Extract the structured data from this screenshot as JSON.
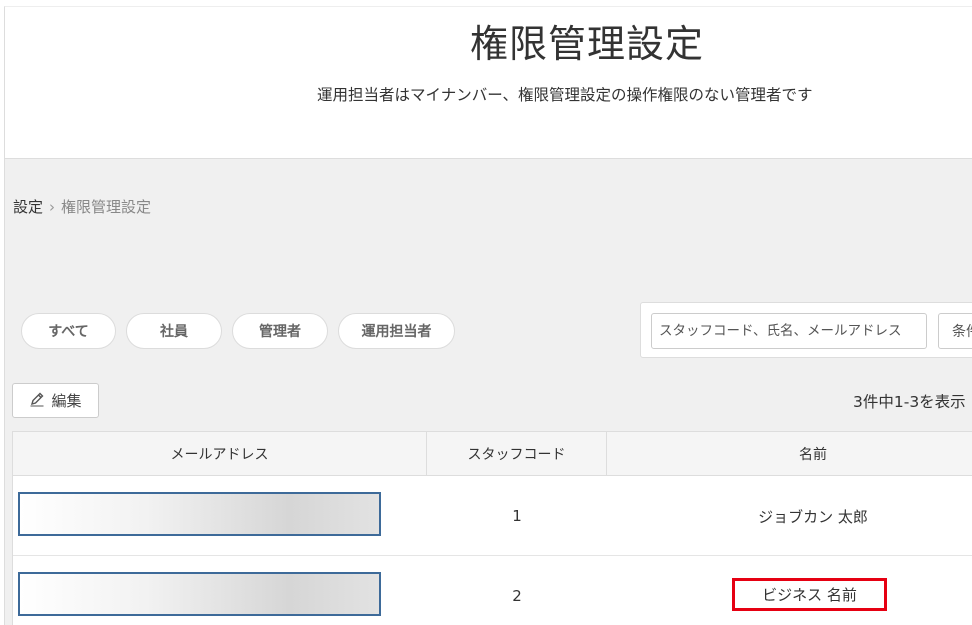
{
  "header": {
    "title": "権限管理設定",
    "description": "運用担当者はマイナンバー、権限管理設定の操作権限のない管理者です"
  },
  "breadcrumb": {
    "root": "設定",
    "separator": "›",
    "current": "権限管理設定"
  },
  "filters": [
    {
      "label": "すべて"
    },
    {
      "label": "社員"
    },
    {
      "label": "管理者"
    },
    {
      "label": "運用担当者"
    }
  ],
  "search": {
    "placeholder": "スタッフコード、氏名、メールアドレス",
    "value": "",
    "condition_label": "条件"
  },
  "toolbar": {
    "edit_label": "編集",
    "edit_icon": "pencil-icon",
    "count_text": "3件中1-3を表示"
  },
  "table": {
    "columns": [
      "メールアドレス",
      "スタッフコード",
      "名前"
    ],
    "rows": [
      {
        "email": "",
        "staff_code": "1",
        "name": "ジョブカン 太郎"
      },
      {
        "email": "",
        "staff_code": "2",
        "name": "ビジネス 名前"
      }
    ]
  },
  "colors": {
    "highlight": "#e60012",
    "redaction_border": "#3d6a99",
    "content_background": "#f0f0f0"
  }
}
